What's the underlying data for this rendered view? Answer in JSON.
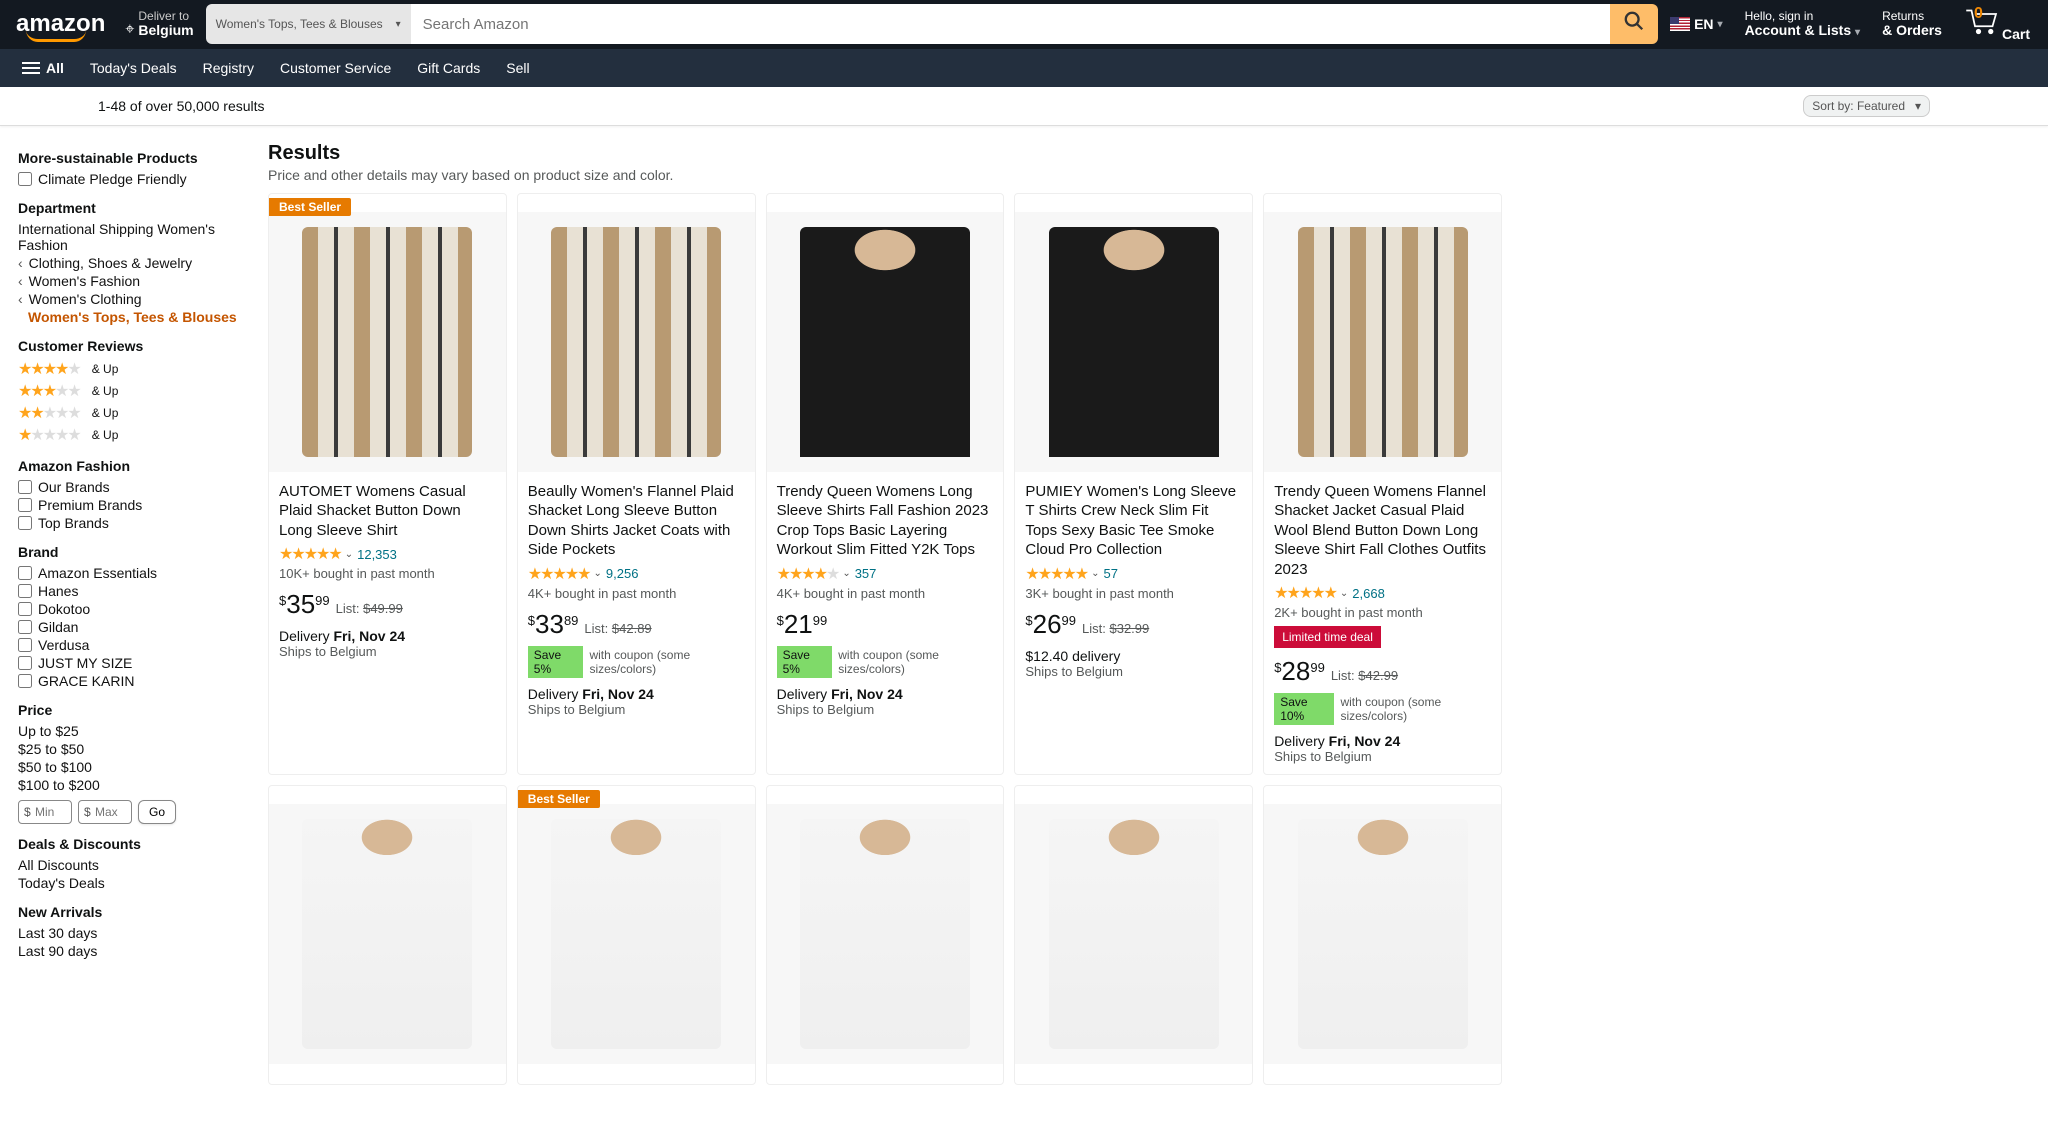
{
  "header": {
    "logo": "amazon",
    "deliver_top": "Deliver to",
    "deliver_bot": "Belgium",
    "search_cat": "Women's Tops, Tees & Blouses",
    "search_placeholder": "Search Amazon",
    "lang": "EN",
    "hello": "Hello, sign in",
    "account": "Account & Lists",
    "returns": "Returns",
    "orders": "& Orders",
    "cart_count": "0",
    "cart": "Cart"
  },
  "nav": [
    "All",
    "Today's Deals",
    "Registry",
    "Customer Service",
    "Gift Cards",
    "Sell"
  ],
  "bar": {
    "count": "1-48 of over 50,000 results",
    "sort_label": "Sort by:",
    "sort_value": "Featured"
  },
  "side": {
    "s1": {
      "h": "More-sustainable Products",
      "items": [
        "Climate Pledge Friendly"
      ]
    },
    "dept": {
      "h": "Department",
      "top": "International Shipping Women's Fashion",
      "crumbs": [
        "Clothing, Shoes & Jewelry",
        "Women's Fashion",
        "Women's Clothing"
      ],
      "sel": "Women's Tops, Tees & Blouses"
    },
    "reviews": {
      "h": "Customer Reviews",
      "up": "& Up"
    },
    "fashion": {
      "h": "Amazon Fashion",
      "items": [
        "Our Brands",
        "Premium Brands",
        "Top Brands"
      ]
    },
    "brand": {
      "h": "Brand",
      "items": [
        "Amazon Essentials",
        "Hanes",
        "Dokotoo",
        "Gildan",
        "Verdusa",
        "JUST MY SIZE",
        "GRACE KARIN"
      ]
    },
    "price": {
      "h": "Price",
      "items": [
        "Up to $25",
        "$25 to $50",
        "$50 to $100",
        "$100 to $200"
      ],
      "min_ph": "Min",
      "max_ph": "Max",
      "go": "Go"
    },
    "deals": {
      "h": "Deals & Discounts",
      "items": [
        "All Discounts",
        "Today's Deals"
      ]
    },
    "newar": {
      "h": "New Arrivals",
      "items": [
        "Last 30 days",
        "Last 90 days"
      ]
    }
  },
  "results": {
    "h": "Results",
    "disclaimer": "Price and other details may vary based on product size and color.",
    "items": [
      {
        "badge": "Best Seller",
        "img": "plaid",
        "title": "AUTOMET Womens Casual Plaid Shacket Button Down Long Sleeve Shirt",
        "stars": 4.5,
        "cnt": "12,353",
        "bought": "10K+ bought in past month",
        "price_w": "35",
        "price_f": "99",
        "list": "$49.99",
        "deliv": "Delivery",
        "deliv_b": "Fri, Nov 24",
        "ships": "Ships to Belgium"
      },
      {
        "img": "plaid",
        "title": "Beaully Women's Flannel Plaid Shacket Long Sleeve Button Down Shirts Jacket Coats with Side Pockets",
        "stars": 4.5,
        "cnt": "9,256",
        "bought": "4K+ bought in past month",
        "price_w": "33",
        "price_f": "89",
        "list": "$42.89",
        "coupon": "Save 5%",
        "coupon_t": "with coupon (some sizes/colors)",
        "deliv": "Delivery",
        "deliv_b": "Fri, Nov 24",
        "ships": "Ships to Belgium"
      },
      {
        "img": "blacktop",
        "title": "Trendy Queen Womens Long Sleeve Shirts Fall Fashion 2023 Crop Tops Basic Layering Workout Slim Fitted Y2K Tops",
        "stars": 4,
        "cnt": "357",
        "bought": "4K+ bought in past month",
        "price_w": "21",
        "price_f": "99",
        "coupon": "Save 5%",
        "coupon_t": "with coupon (some sizes/colors)",
        "deliv": "Delivery",
        "deliv_b": "Fri, Nov 24",
        "ships": "Ships to Belgium"
      },
      {
        "img": "blacktop",
        "title": "PUMIEY Women's Long Sleeve T Shirts Crew Neck Slim Fit Tops Sexy Basic Tee Smoke Cloud Pro Collection",
        "stars": 4.5,
        "cnt": "57",
        "bought": "3K+ bought in past month",
        "price_w": "26",
        "price_f": "99",
        "list": "$32.99",
        "ship_cost": "$12.40 delivery",
        "ships": "Ships to Belgium"
      },
      {
        "img": "plaid",
        "title": "Trendy Queen Womens Flannel Shacket Jacket Casual Plaid Wool Blend Button Down Long Sleeve Shirt Fall Clothes Outfits 2023",
        "stars": 4.5,
        "cnt": "2,668",
        "bought": "2K+ bought in past month",
        "deal": "Limited time deal",
        "price_w": "28",
        "price_f": "99",
        "list": "$42.99",
        "coupon": "Save 10%",
        "coupon_t": "with coupon (some sizes/colors)",
        "deliv": "Delivery",
        "deliv_b": "Fri, Nov 24",
        "ships": "Ships to Belgium"
      },
      {
        "img": "whiteshirt"
      },
      {
        "badge": "Best Seller",
        "img": "whiteshirt"
      },
      {
        "img": "whiteshirt"
      },
      {
        "img": "whiteshirt"
      },
      {
        "img": "whiteshirt"
      }
    ]
  },
  "labels": {
    "list": "List:",
    "dollar": "$"
  }
}
